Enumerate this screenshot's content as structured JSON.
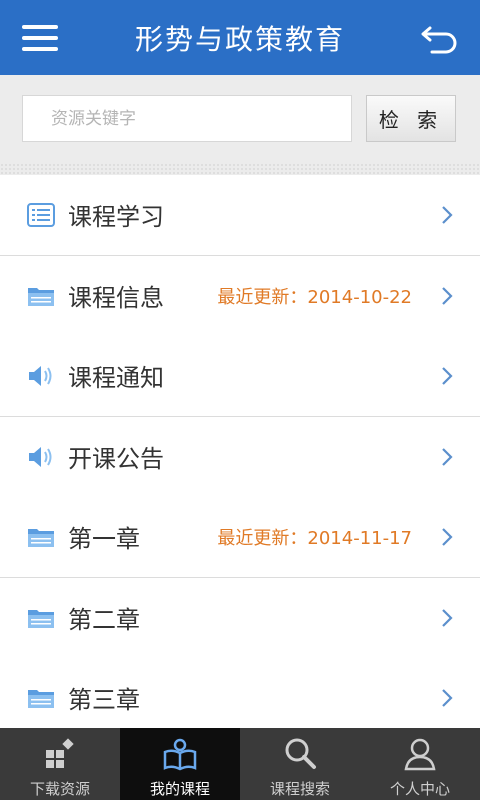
{
  "header": {
    "title": "形势与政策教育"
  },
  "search": {
    "placeholder": "资源关键字",
    "button_label": "检 索"
  },
  "menu": [
    {
      "label": "课程学习",
      "icon": "list-icon",
      "update": ""
    },
    {
      "label": "课程信息",
      "icon": "folder-icon",
      "update": "最近更新：2014-10-22"
    },
    {
      "label": "课程通知",
      "icon": "speaker-icon",
      "update": ""
    },
    {
      "label": "开课公告",
      "icon": "speaker-icon",
      "update": ""
    },
    {
      "label": "第一章",
      "icon": "folder-icon",
      "update": "最近更新：2014-11-17"
    },
    {
      "label": "第二章",
      "icon": "folder-icon",
      "update": ""
    },
    {
      "label": "第三章",
      "icon": "folder-icon",
      "update": ""
    }
  ],
  "tabs": [
    {
      "label": "下载资源",
      "icon": "download-grid-icon",
      "active": false
    },
    {
      "label": "我的课程",
      "icon": "book-icon",
      "active": true
    },
    {
      "label": "课程搜索",
      "icon": "search-icon",
      "active": false
    },
    {
      "label": "个人中心",
      "icon": "user-icon",
      "active": false
    }
  ],
  "colors": {
    "header": "#2b6fc6",
    "update_text": "#e07a26",
    "icon_blue": "#5b9de0"
  }
}
